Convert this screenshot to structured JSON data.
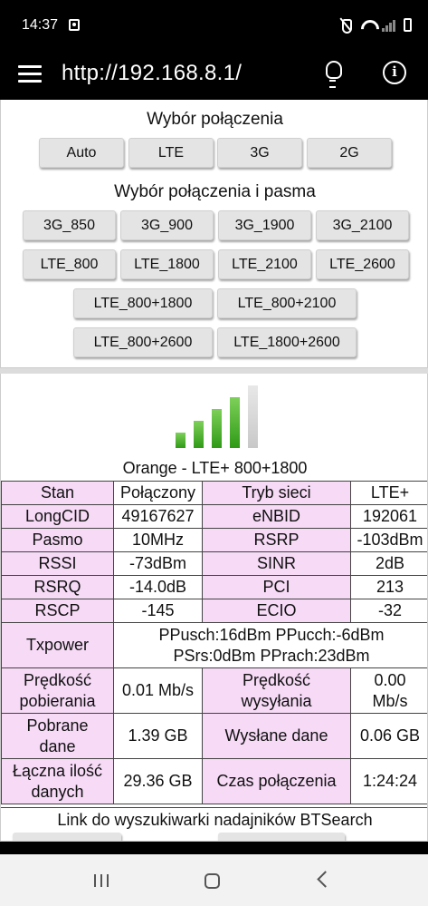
{
  "status_bar": {
    "time": "14:37",
    "icons": [
      "gallery-icon",
      "mute-icon",
      "wifi-icon",
      "signal-icon",
      "battery-icon"
    ]
  },
  "app_bar": {
    "title": "http://192.168.8.1/",
    "icons": [
      "menu-icon",
      "bulb-icon",
      "info-icon"
    ],
    "info_glyph": "i"
  },
  "connection_select": {
    "heading": "Wybór połączenia",
    "buttons": [
      "Auto",
      "LTE",
      "3G",
      "2G"
    ]
  },
  "band_select": {
    "heading": "Wybór połączenia i pasma",
    "buttons": [
      "3G_850",
      "3G_900",
      "3G_1900",
      "3G_2100",
      "LTE_800",
      "LTE_1800",
      "LTE_2100",
      "LTE_2600",
      "LTE_800+1800",
      "LTE_800+2100",
      "LTE_800+2600",
      "LTE_1800+2600"
    ]
  },
  "signal": {
    "bars_total": 5,
    "bars_active": 4
  },
  "operator_line": "Orange - LTE+ 800+1800",
  "info_table": {
    "stan_label": "Stan",
    "stan_value": "Połączony",
    "tryb_label": "Tryb sieci",
    "tryb_value": "LTE+",
    "longcid_label": "LongCID",
    "longcid_value": "49167627",
    "enbid_label": "eNBID",
    "enbid_value": "192061",
    "pasmo_label": "Pasmo",
    "pasmo_value": "10MHz",
    "rsrp_label": "RSRP",
    "rsrp_value": "-103dBm",
    "rssi_label": "RSSI",
    "rssi_value": "-73dBm",
    "sinr_label": "SINR",
    "sinr_value": "2dB",
    "rsrq_label": "RSRQ",
    "rsrq_value": "-14.0dB",
    "pci_label": "PCI",
    "pci_value": "213",
    "rscp_label": "RSCP",
    "rscp_value": "-145",
    "ecio_label": "ECIO",
    "ecio_value": "-32",
    "txpower_label": "Txpower",
    "txpower_value": "PPusch:16dBm PPucch:-6dBm PSrs:0dBm PPrach:23dBm",
    "dl_speed_label": "Prędkość pobierania",
    "dl_speed_value": "0.01 Mb/s",
    "ul_speed_label": "Prędkość wysyłania",
    "ul_speed_value": "0.00 Mb/s",
    "downloaded_label": "Pobrane dane",
    "downloaded_value": "1.39 GB",
    "uploaded_label": "Wysłane dane",
    "uploaded_value": "0.06 GB",
    "total_label": "Łączna ilość danych",
    "total_value": "29.36 GB",
    "conn_time_label": "Czas połączenia",
    "conn_time_value": "1:24:24"
  },
  "link_text": "Link do wyszukiwarki nadajników BTSearch",
  "nav_bar": {
    "icons": [
      "recents-icon",
      "home-icon",
      "back-icon"
    ]
  },
  "colors": {
    "label_bg": "#f6daf6",
    "bar_active": "#3fa820",
    "bar_inactive": "#d0d0d0",
    "button_bg": "#e4e4e4"
  }
}
